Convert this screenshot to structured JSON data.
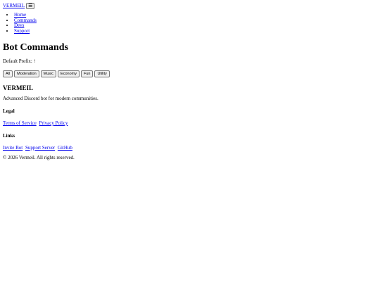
{
  "header": {
    "brand": "VERMEIL",
    "menu_icon": "hamburger-icon",
    "menu_glyph": "☰",
    "nav": [
      "Home",
      "Commands",
      "Devs",
      "Support"
    ]
  },
  "main": {
    "title": "Bot Commands",
    "prefix_label": "Default Prefix:",
    "prefix_value": "!",
    "filters": [
      "All",
      "Moderation",
      "Music",
      "Economy",
      "Fun",
      "Utility"
    ]
  },
  "footer": {
    "brand": "VERMEIL",
    "tagline": "Advanced Discord bot for modern communities.",
    "legal_heading": "Legal",
    "legal_links": [
      "Terms of Service",
      "Privacy Policy"
    ],
    "links_heading": "Links",
    "links": [
      "Invite Bot",
      "Support Server",
      "GitHub"
    ],
    "copyright": "© 2026 Vermeil. All rights reserved."
  }
}
